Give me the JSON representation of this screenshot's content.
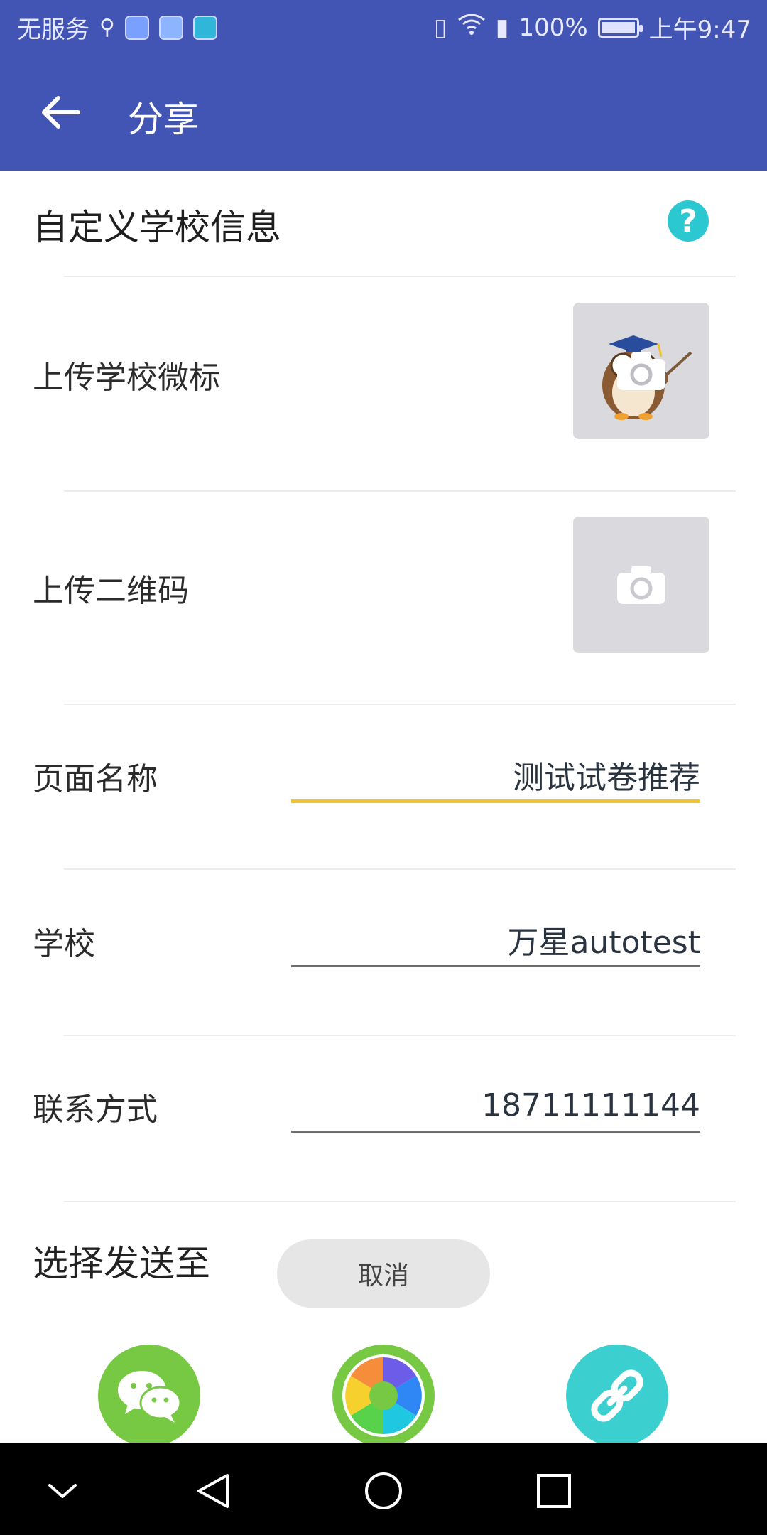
{
  "status_bar": {
    "carrier": "无服务",
    "battery": "100%",
    "time": "上午9:47"
  },
  "app_bar": {
    "title": "分享"
  },
  "custom_section": {
    "title": "自定义学校信息",
    "help_symbol": "?"
  },
  "uploads": {
    "logo_label": "上传学校微标",
    "qr_label": "上传二维码"
  },
  "fields": {
    "page_name_label": "页面名称",
    "page_name_value": "测试试卷推荐",
    "school_label": "学校",
    "school_value": "万星autotest",
    "contact_label": "联系方式",
    "contact_value": "18711111144"
  },
  "send": {
    "label": "选择发送至",
    "cancel": "取消",
    "targets": [
      "wechat-icon",
      "moments-icon",
      "link-icon"
    ]
  },
  "colors": {
    "appbar": "#4355b4",
    "accent_underline": "#f4c430",
    "help": "#2bc8d2",
    "wechat_green": "#77c943",
    "link_teal": "#3ccfcf"
  }
}
